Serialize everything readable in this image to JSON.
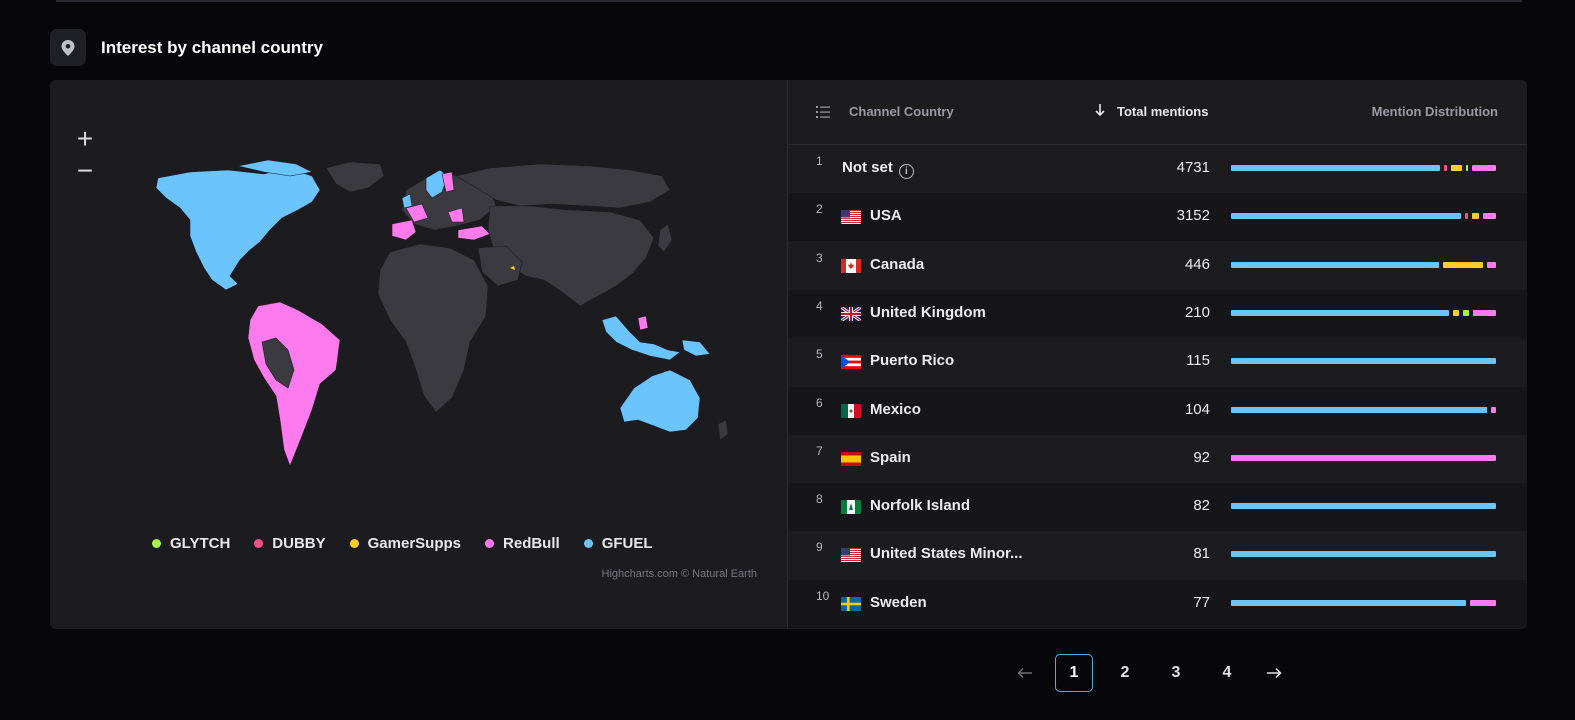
{
  "section": {
    "title": "Interest by channel country",
    "icon": "location-pin-icon"
  },
  "map": {
    "zoom_in": "+",
    "zoom_out": "−",
    "credits": "Highcharts.com © Natural Earth",
    "legend": [
      {
        "label": "GLYTCH",
        "color": "#a4f54a"
      },
      {
        "label": "DUBBY",
        "color": "#ff4f86"
      },
      {
        "label": "GamerSupps",
        "color": "#ffcd2c"
      },
      {
        "label": "RedBull",
        "color": "#ff7aec"
      },
      {
        "label": "GFUEL",
        "color": "#6cc4ff"
      }
    ]
  },
  "table": {
    "headers": {
      "country": "Channel Country",
      "total": "Total mentions",
      "distribution": "Mention Distribution"
    },
    "rows": [
      {
        "rank": "1",
        "name": "Not set",
        "value": "4731",
        "flag": "none",
        "segments": [
          {
            "color": "#6cc4ff",
            "share": 0.84
          },
          {
            "color": "#ff4f86",
            "share": 0.01
          },
          {
            "color": "#ffcd2c",
            "share": 0.045
          },
          {
            "color": "#a4f54a",
            "share": 0.008
          },
          {
            "color": "#ff7aec",
            "share": 0.045
          }
        ]
      },
      {
        "rank": "2",
        "name": "USA",
        "value": "3152",
        "flag": "us",
        "segments": [
          {
            "color": "#6cc4ff",
            "share": 0.91
          },
          {
            "color": "#ff4f86",
            "share": 0.01
          },
          {
            "color": "#ffcd2c",
            "share": 0.03
          },
          {
            "color": "#ff7aec",
            "share": 0.01
          }
        ]
      },
      {
        "rank": "3",
        "name": "Canada",
        "value": "446",
        "flag": "ca",
        "segments": [
          {
            "color": "#6cc4ff",
            "share": 0.81
          },
          {
            "color": "#ffcd2c",
            "share": 0.155
          },
          {
            "color": "#ff7aec",
            "share": 0.01
          }
        ]
      },
      {
        "rank": "4",
        "name": "United Kingdom",
        "value": "210",
        "flag": "gb",
        "segments": [
          {
            "color": "#6cc4ff",
            "share": 0.86
          },
          {
            "color": "#ffcd2c",
            "share": 0.025
          },
          {
            "color": "#a4f54a",
            "share": 0.025
          },
          {
            "color": "#ff7aec",
            "share": 0.045
          }
        ]
      },
      {
        "rank": "5",
        "name": "Puerto Rico",
        "value": "115",
        "flag": "pr",
        "segments": [
          {
            "color": "#6cc4ff",
            "share": 1.0
          }
        ]
      },
      {
        "rank": "6",
        "name": "Mexico",
        "value": "104",
        "flag": "mx",
        "segments": [
          {
            "color": "#6cc4ff",
            "share": 0.98
          },
          {
            "color": "#ff7aec",
            "share": 0.01
          }
        ]
      },
      {
        "rank": "7",
        "name": "Spain",
        "value": "92",
        "flag": "es",
        "segments": [
          {
            "color": "#ff7aec",
            "share": 1.0
          }
        ]
      },
      {
        "rank": "8",
        "name": "Norfolk Island",
        "value": "82",
        "flag": "nf",
        "segments": [
          {
            "color": "#6cc4ff",
            "share": 1.0
          }
        ]
      },
      {
        "rank": "9",
        "name": "United States Minor...",
        "value": "81",
        "flag": "us",
        "segments": [
          {
            "color": "#6cc4ff",
            "share": 1.0
          }
        ]
      },
      {
        "rank": "10",
        "name": "Sweden",
        "value": "77",
        "flag": "se",
        "segments": [
          {
            "color": "#6cc4ff",
            "share": 0.9
          },
          {
            "color": "#ff7aec",
            "share": 0.09
          }
        ]
      }
    ]
  },
  "pagination": {
    "pages": [
      "1",
      "2",
      "3",
      "4"
    ],
    "active": "1"
  }
}
